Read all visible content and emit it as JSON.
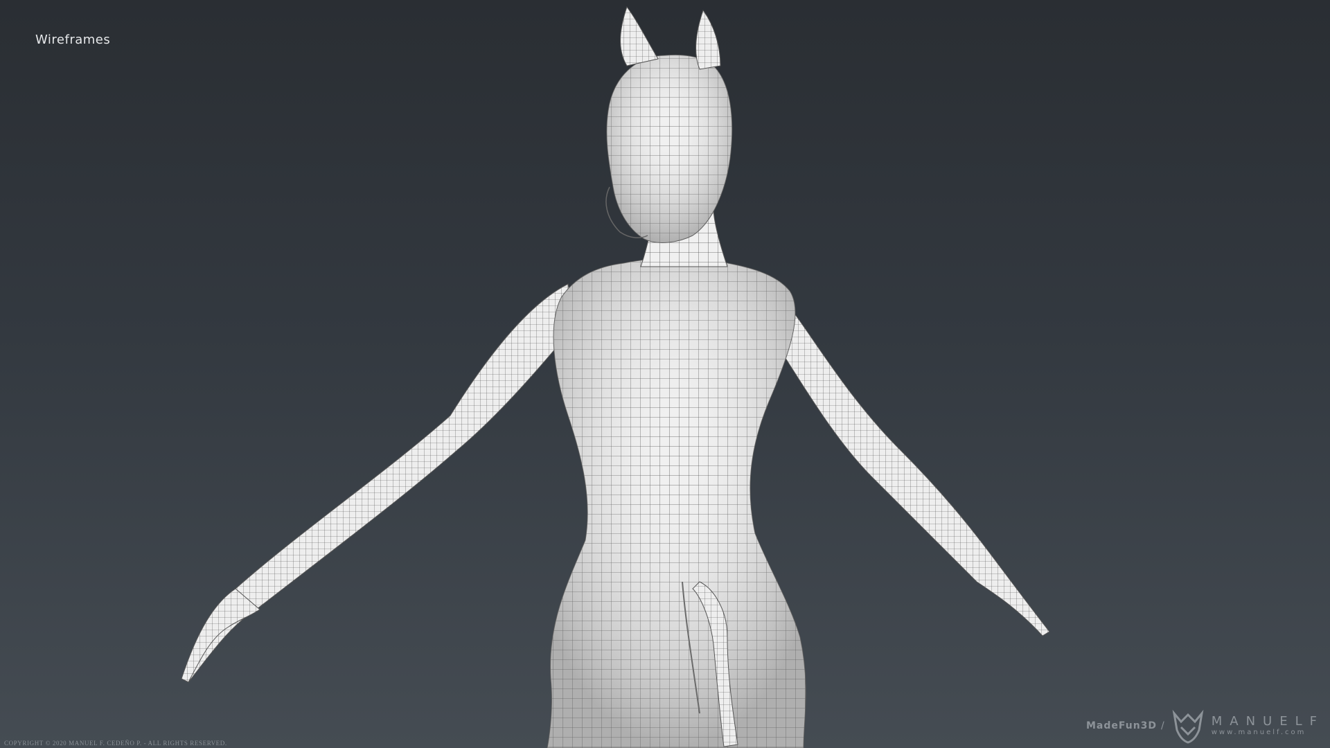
{
  "title": "Wireframes",
  "copyright": "COPYRIGHT © 2020 MANUEL F. CEDEÑO P. - ALL RIGHTS RESERVED.",
  "watermark": {
    "studio": "MadeFun3D",
    "separator": "/",
    "brand": "MANUELF",
    "url": "www.manuelf.com"
  },
  "figure": {
    "subject": "wireframe-character-back-view",
    "mesh_color": "#f2f2f2",
    "wire_color": "#3a3a3a"
  },
  "colors": {
    "background_top": "#2a2e33",
    "background_bottom": "#454c53",
    "text": "#e6e8ea",
    "watermark": "#8d9399"
  }
}
